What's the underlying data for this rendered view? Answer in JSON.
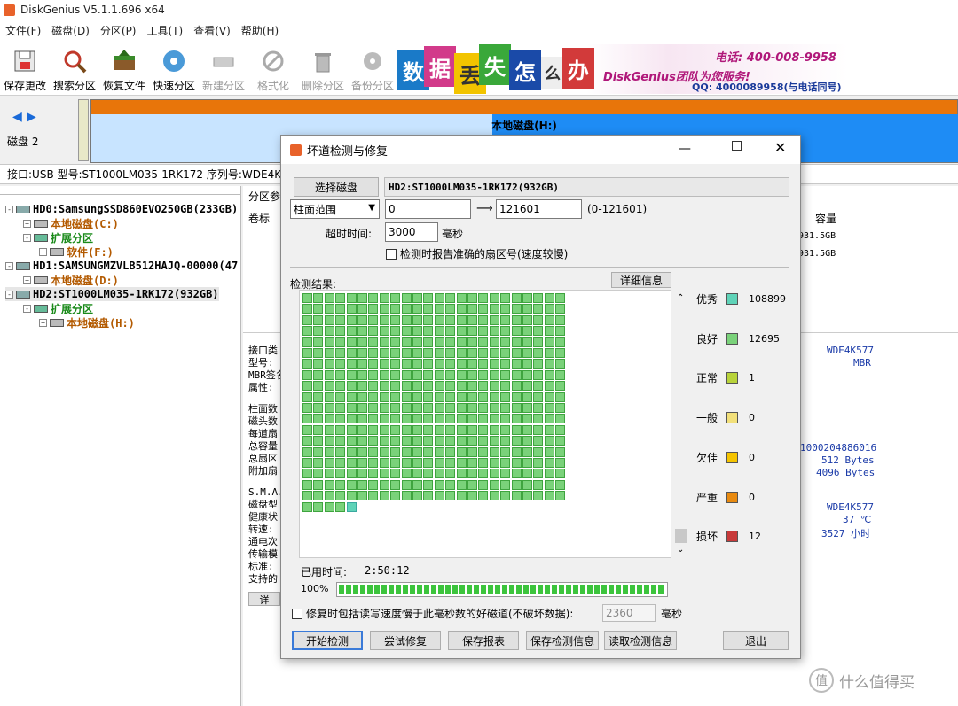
{
  "window_title": "DiskGenius V5.1.1.696 x64",
  "menu": [
    "文件(F)",
    "磁盘(D)",
    "分区(P)",
    "工具(T)",
    "查看(V)",
    "帮助(H)"
  ],
  "toolbar": [
    {
      "label": "保存更改",
      "icon": "save-icon",
      "enabled": true
    },
    {
      "label": "搜索分区",
      "icon": "magnify-icon",
      "enabled": true
    },
    {
      "label": "恢复文件",
      "icon": "box-icon",
      "enabled": true
    },
    {
      "label": "快速分区",
      "icon": "disc-icon",
      "enabled": true
    },
    {
      "label": "新建分区",
      "icon": "drive-icon",
      "enabled": false
    },
    {
      "label": "格式化",
      "icon": "format-icon",
      "enabled": false
    },
    {
      "label": "删除分区",
      "icon": "trash-icon",
      "enabled": false
    },
    {
      "label": "备份分区",
      "icon": "backup-icon",
      "enabled": false
    }
  ],
  "banner": {
    "chars": [
      "数",
      "据",
      "丢",
      "失",
      "怎",
      "么",
      "办"
    ],
    "brand": "DiskGenius团队为您服务!",
    "phone": "电话: 400-008-9958",
    "qq": "QQ: 4000089958(与电话同号)"
  },
  "disk_strip": {
    "disk_label": "磁盘 2",
    "partition_label": "本地磁盘(H:)"
  },
  "disk_info": "接口:USB  型号:ST1000LM035-1RK172  序列号:WDE4K577",
  "tree": [
    {
      "text": "HD0:SamsungSSD860EVO250GB(233GB)",
      "color": "blk"
    },
    {
      "text": "本地磁盘(C:)",
      "color": "orange"
    },
    {
      "text": "扩展分区",
      "color": "green"
    },
    {
      "text": "软件(F:)",
      "color": "orange"
    },
    {
      "text": "HD1:SAMSUNGMZVLB512HAJQ-00000(47",
      "color": "blk"
    },
    {
      "text": "本地磁盘(D:)",
      "color": "orange"
    },
    {
      "text": "HD2:ST1000LM035-1RK172(932GB)",
      "color": "blk"
    },
    {
      "text": "扩展分区",
      "color": "green"
    },
    {
      "text": "本地磁盘(H:)",
      "color": "orange"
    }
  ],
  "right_panel": {
    "tab": "分区参",
    "col_label": "卷标",
    "col_capacity": "容量",
    "cap1": "931.5GB",
    "cap2": "931.5GB",
    "left_labels": [
      "接口类",
      "型号:",
      "MBR签名",
      "属性:",
      "柱面数",
      "磁头数",
      "每道扇",
      "总容量",
      "总扇区",
      "附加扇",
      "S.M.A.",
      "磁盘型",
      "健康状",
      "转速:",
      "通电次",
      "传输模",
      "标准:",
      "支持的"
    ],
    "values": [
      "WDE4K577",
      "MBR",
      "1000204886016",
      "512 Bytes",
      "4096 Bytes",
      "WDE4K577",
      "37 ℃",
      "3527 小时"
    ],
    "partial_button": "详"
  },
  "dialog": {
    "title": "坏道检测与修复",
    "select_disk": "选择磁盘",
    "disk_name": "HD2:ST1000LM035-1RK172(932GB)",
    "range_type": "柱面范围",
    "range_from": "0",
    "range_to": "121601",
    "range_hint": "(0-121601)",
    "timeout_label": "超时时间:",
    "timeout_value": "3000",
    "timeout_unit": "毫秒",
    "report_sector_label": "检测时报告准确的扇区号(速度较慢)",
    "result_label": "检测结果:",
    "detail_button": "详细信息",
    "legend": [
      {
        "label": "优秀",
        "color": "#5fd3b8",
        "count": "108899"
      },
      {
        "label": "良好",
        "color": "#7ad27a",
        "count": "12695"
      },
      {
        "label": "正常",
        "color": "#b8d33a",
        "count": "1"
      },
      {
        "label": "一般",
        "color": "#f2e07a",
        "count": "0"
      },
      {
        "label": "欠佳",
        "color": "#f5c400",
        "count": "0"
      },
      {
        "label": "严重",
        "color": "#e88a10",
        "count": "0"
      },
      {
        "label": "损坏",
        "color": "#c83a3a",
        "count": "12"
      }
    ],
    "elapsed_label": "已用时间:",
    "elapsed_value": "2:50:12",
    "progress_text": "100%",
    "progress": 1.0,
    "repair_option_label": "修复时包括读写速度慢于此毫秒数的好磁道(不破坏数据):",
    "repair_ms": "2360",
    "repair_ms_unit": "毫秒",
    "buttons": [
      "开始检测",
      "尝试修复",
      "保存报表",
      "保存检测信息",
      "读取检测信息",
      "退出"
    ]
  },
  "watermark": "值 什么值得买"
}
